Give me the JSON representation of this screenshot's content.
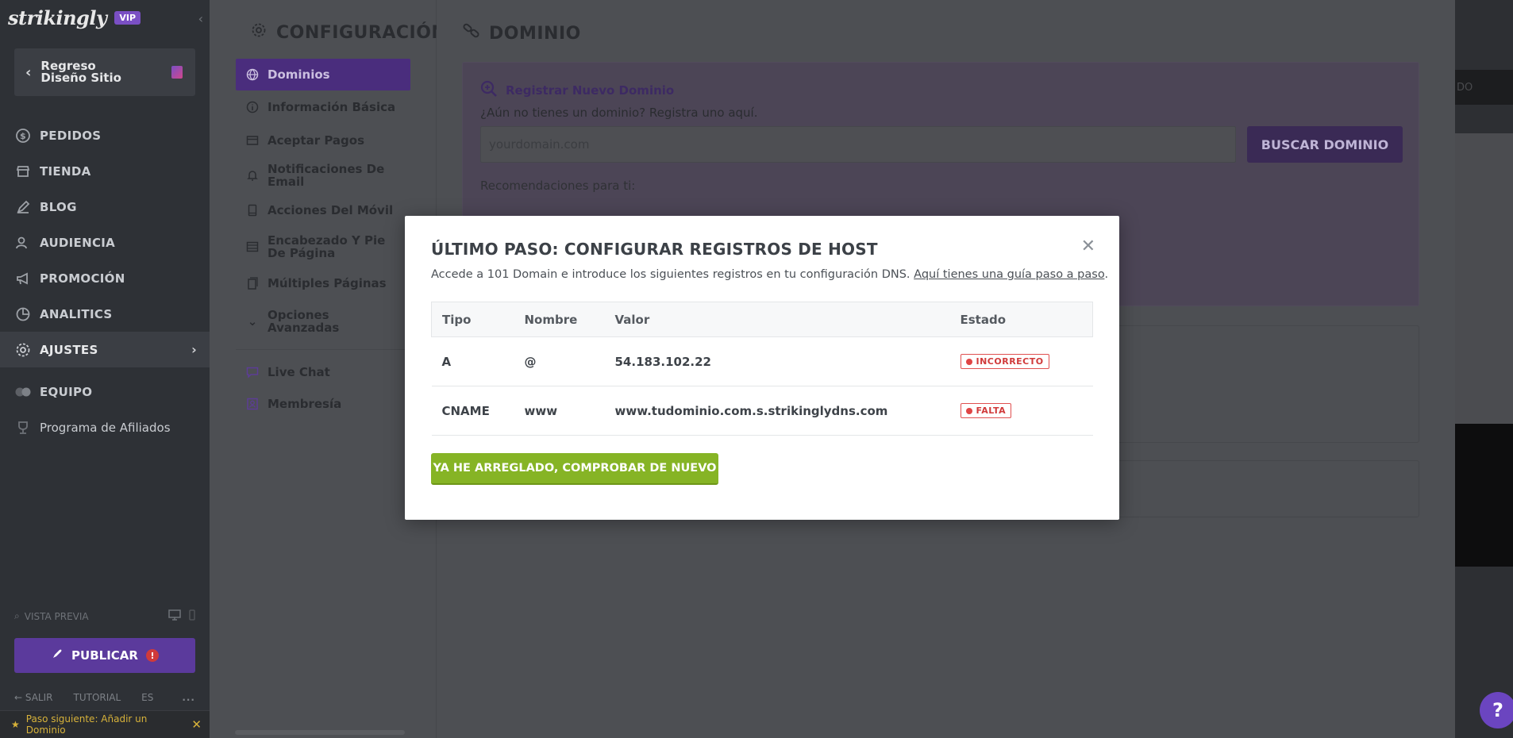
{
  "brand": {
    "name": "strikingly",
    "badge": "VIP"
  },
  "sidebar": {
    "back_label": "Regreso Diseño Sitio",
    "items": [
      {
        "label": "PEDIDOS",
        "icon": "dollar-icon"
      },
      {
        "label": "TIENDA",
        "icon": "store-icon"
      },
      {
        "label": "BLOG",
        "icon": "pen-icon"
      },
      {
        "label": "AUDIENCIA",
        "icon": "users-icon"
      },
      {
        "label": "PROMOCIÓN",
        "icon": "megaphone-icon"
      },
      {
        "label": "ANALITICS",
        "icon": "chart-icon"
      },
      {
        "label": "AJUSTES",
        "icon": "gear-icon"
      }
    ],
    "extra_items": [
      {
        "label": "EQUIPO",
        "icon": "team-icon"
      },
      {
        "label": "Programa de Afiliados",
        "icon": "trophy-icon"
      }
    ],
    "preview_label": "VISTA PREVIA",
    "publish_label": "PUBLICAR",
    "publish_alert": "!",
    "bottom": {
      "exit": "SALIR",
      "tutorial": "TUTORIAL",
      "lang": "ES",
      "more": "..."
    },
    "next_step": "Paso siguiente: Añadir un Dominio"
  },
  "settings": {
    "title": "CONFIGURACIÓN",
    "items": [
      {
        "label": "Dominios",
        "icon": "globe-icon"
      },
      {
        "label": "Información Básica",
        "icon": "info-icon"
      },
      {
        "label": "Aceptar Pagos",
        "icon": "card-icon"
      },
      {
        "label": "Notificaciones De Email",
        "icon": "bell-icon"
      },
      {
        "label": "Acciones Del Móvil",
        "icon": "mobile-icon"
      },
      {
        "label": "Encabezado Y Pie De Página",
        "icon": "layout-icon"
      },
      {
        "label": "Múltiples Páginas",
        "icon": "pages-icon"
      },
      {
        "label": "Opciones Avanzadas",
        "icon": "chevron-down-icon"
      }
    ],
    "extra": [
      {
        "label": "Live Chat",
        "icon": "chat-icon"
      },
      {
        "label": "Membresía",
        "icon": "member-icon"
      }
    ]
  },
  "main": {
    "title": "DOMINIO",
    "register": {
      "title": "Registrar Nuevo Dominio",
      "subtitle": "¿Aún no tienes un dominio? Registra uno aquí.",
      "placeholder": "yourdomain.com",
      "button": "BUSCAR DOMINIO",
      "recommendations": "Recomendaciones para ti:"
    },
    "preview_bar_text": "DO"
  },
  "modal": {
    "title": "ÚLTIMO PASO: CONFIGURAR REGISTROS DE HOST",
    "desc_prefix": "Accede a 101 Domain e introduce los siguientes registros en tu configuración DNS. ",
    "desc_link": "Aquí tienes una guía paso a paso",
    "desc_suffix": ".",
    "columns": [
      "Tipo",
      "Nombre",
      "Valor",
      "Estado"
    ],
    "rows": [
      {
        "type": "A",
        "name": "@",
        "value": "54.183.102.22",
        "status": "INCORRECTO"
      },
      {
        "type": "CNAME",
        "name": "www",
        "value": "www.tudominio.com.s.strikinglydns.com",
        "status": "FALTA"
      }
    ],
    "button": "YA HE ARREGLADO, COMPROBAR DE NUEVO"
  },
  "help": "?"
}
